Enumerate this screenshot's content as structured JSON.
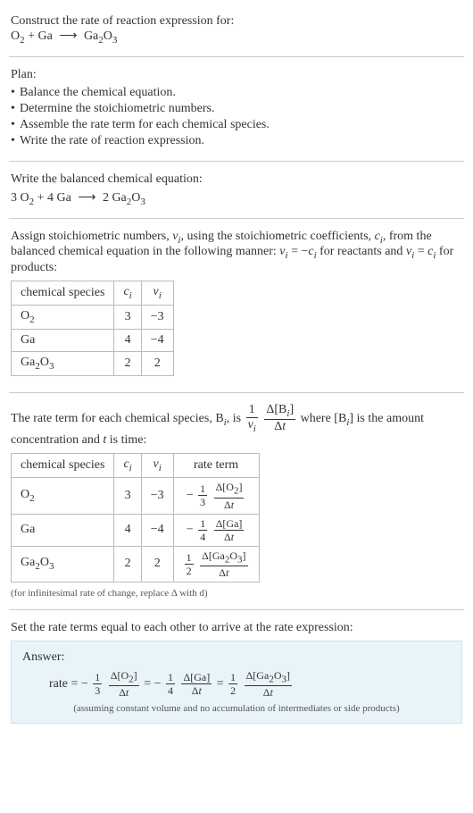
{
  "intro": {
    "construct_line": "Construct the rate of reaction expression for:",
    "unbalanced": {
      "o2": "O",
      "o2_sub": "2",
      "plus": " + ",
      "ga": "Ga",
      "arrow": "⟶",
      "pr": "Ga",
      "pr_sub1": "2",
      "pr_mid": "O",
      "pr_sub2": "3"
    }
  },
  "plan": {
    "heading": "Plan:",
    "items": [
      "Balance the chemical equation.",
      "Determine the stoichiometric numbers.",
      "Assemble the rate term for each chemical species.",
      "Write the rate of reaction expression."
    ]
  },
  "balanced": {
    "heading": "Write the balanced chemical equation:",
    "c1": "3 ",
    "o2": "O",
    "o2_sub": "2",
    "plus": " + ",
    "c2": "4 ",
    "ga": "Ga",
    "arrow": "⟶",
    "c3": "2 ",
    "pr": "Ga",
    "pr_sub1": "2",
    "pr_mid": "O",
    "pr_sub2": "3"
  },
  "assign": {
    "para_pre": "Assign stoichiometric numbers, ",
    "nu": "ν",
    "nu_sub": "i",
    "para_mid1": ", using the stoichiometric coefficients, ",
    "c": "c",
    "c_sub": "i",
    "para_mid2": ", from the balanced chemical equation in the following manner: ",
    "eq1_l": "ν",
    "eq1_ls": "i",
    "eq1_eq": " = −",
    "eq1_r": "c",
    "eq1_rs": "i",
    "para_mid3": " for reactants and ",
    "eq2_l": "ν",
    "eq2_ls": "i",
    "eq2_eq": " = ",
    "eq2_r": "c",
    "eq2_rs": "i",
    "para_end": " for products:"
  },
  "table1": {
    "h1": "chemical species",
    "h2": "c",
    "h2s": "i",
    "h3": "ν",
    "h3s": "i",
    "rows": [
      {
        "sp": "O",
        "sp_s": "2",
        "sp_tail": "",
        "c": "3",
        "nu": "−3"
      },
      {
        "sp": "Ga",
        "sp_s": "",
        "sp_tail": "",
        "c": "4",
        "nu": "−4"
      },
      {
        "sp": "Ga",
        "sp_s": "2",
        "sp_tail": "O",
        "sp_s2": "3",
        "c": "2",
        "nu": "2"
      }
    ]
  },
  "rate_para": {
    "p1": "The rate term for each chemical species, ",
    "B": "B",
    "Bs": "i",
    "p2": ", is ",
    "frac1_num": "1",
    "frac1_den_a": "ν",
    "frac1_den_s": "i",
    "frac2_num_a": "Δ[B",
    "frac2_num_s": "i",
    "frac2_num_b": "]",
    "frac2_den_a": "Δ",
    "frac2_den_t": "t",
    "p3": " where [B",
    "p3s": "i",
    "p3b": "] is the amount concentration and ",
    "t": "t",
    "p4": " is time:"
  },
  "table2": {
    "h1": "chemical species",
    "h2": "c",
    "h2s": "i",
    "h3": "ν",
    "h3s": "i",
    "h4": "rate term",
    "rows": [
      {
        "sp": "O",
        "sp_s": "2",
        "sp_tail": "",
        "sp_s2": "",
        "c": "3",
        "nu": "−3",
        "sign": "−",
        "fn": "1",
        "fd": "3",
        "num": "Δ[O",
        "num_s": "2",
        "num_b": "]",
        "den": "Δ",
        "den_t": "t"
      },
      {
        "sp": "Ga",
        "sp_s": "",
        "sp_tail": "",
        "sp_s2": "",
        "c": "4",
        "nu": "−4",
        "sign": "−",
        "fn": "1",
        "fd": "4",
        "num": "Δ[Ga]",
        "num_s": "",
        "num_b": "",
        "den": "Δ",
        "den_t": "t"
      },
      {
        "sp": "Ga",
        "sp_s": "2",
        "sp_tail": "O",
        "sp_s2": "3",
        "c": "2",
        "nu": "2",
        "sign": "",
        "fn": "1",
        "fd": "2",
        "num": "Δ[Ga",
        "num_s": "2",
        "num_b": "O",
        "num_s2": "3",
        "num_c": "]",
        "den": "Δ",
        "den_t": "t"
      }
    ],
    "note": "(for infinitesimal rate of change, replace Δ with d)"
  },
  "final": {
    "heading": "Set the rate terms equal to each other to arrive at the rate expression:",
    "answer_label": "Answer:",
    "rate": "rate = ",
    "t1": {
      "sign": "−",
      "fn": "1",
      "fd": "3",
      "num": "Δ[O",
      "num_s": "2",
      "num_b": "]",
      "den": "Δ",
      "den_t": "t"
    },
    "eq": " = ",
    "t2": {
      "sign": "−",
      "fn": "1",
      "fd": "4",
      "num": "Δ[Ga]",
      "num_s": "",
      "num_b": "",
      "den": "Δ",
      "den_t": "t"
    },
    "t3": {
      "sign": "",
      "fn": "1",
      "fd": "2",
      "num": "Δ[Ga",
      "num_s": "2",
      "num_b": "O",
      "num_s2": "3",
      "num_c": "]",
      "den": "Δ",
      "den_t": "t"
    },
    "assume": "(assuming constant volume and no accumulation of intermediates or side products)"
  },
  "chart_data": {
    "type": "table",
    "stoichiometry": {
      "columns": [
        "chemical species",
        "c_i",
        "nu_i"
      ],
      "rows": [
        [
          "O2",
          3,
          -3
        ],
        [
          "Ga",
          4,
          -4
        ],
        [
          "Ga2O3",
          2,
          2
        ]
      ]
    },
    "rate_terms": {
      "columns": [
        "chemical species",
        "c_i",
        "nu_i",
        "rate term"
      ],
      "rows": [
        [
          "O2",
          3,
          -3,
          "-(1/3) d[O2]/dt"
        ],
        [
          "Ga",
          4,
          -4,
          "-(1/4) d[Ga]/dt"
        ],
        [
          "Ga2O3",
          2,
          2,
          "(1/2) d[Ga2O3]/dt"
        ]
      ]
    },
    "balanced_equation": "3 O2 + 4 Ga -> 2 Ga2O3",
    "rate_expression": "rate = -(1/3) d[O2]/dt = -(1/4) d[Ga]/dt = (1/2) d[Ga2O3]/dt"
  }
}
